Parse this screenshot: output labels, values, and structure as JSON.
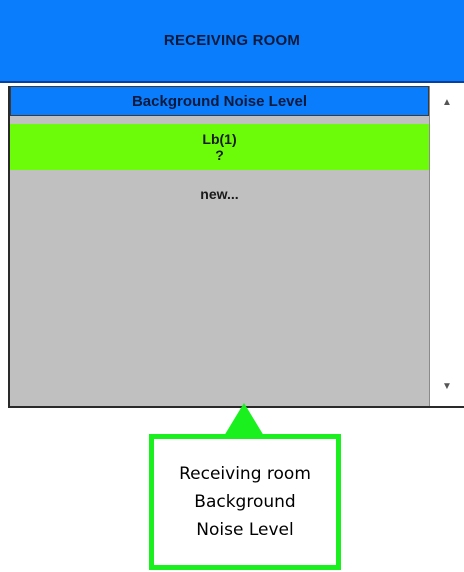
{
  "header": {
    "title": "RECEIVING ROOM"
  },
  "column": {
    "header": "Background Noise Level",
    "rows": [
      {
        "label": "Lb(1)",
        "value": "?"
      }
    ],
    "new_label": "new..."
  },
  "scrollbar": {
    "up_icon": "triangle-up",
    "down_icon": "triangle-down"
  },
  "callout": {
    "lines": [
      "Receiving room",
      "Background",
      "Noise Level"
    ]
  },
  "colors": {
    "header_blue": "#0a7dfc",
    "active_cell_green": "#6cfc0a",
    "list_gray": "#c0c0c0",
    "annotation_green": "#19f01e"
  }
}
